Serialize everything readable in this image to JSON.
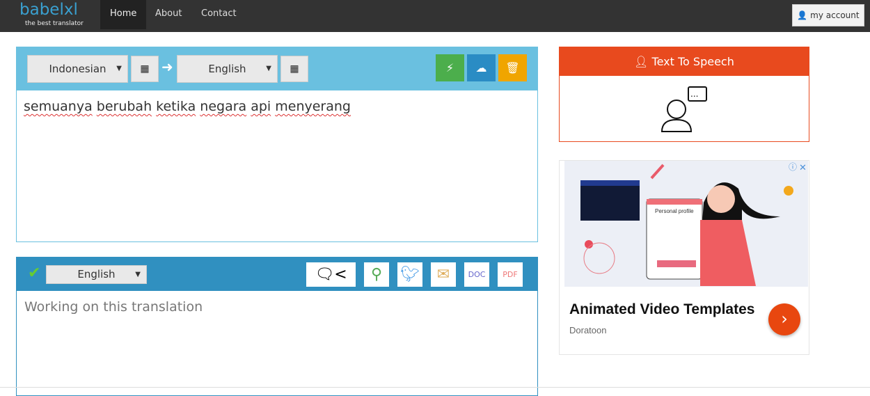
{
  "nav": {
    "logo": "babelxl",
    "tagline": "the best translator",
    "links": [
      "Home",
      "About",
      "Contact"
    ],
    "active": "Home",
    "account": "my account"
  },
  "source": {
    "language": "Indonesian",
    "target_language": "English",
    "text_words": [
      "semuanya",
      "berubah",
      "ketika",
      "negara",
      "api",
      "menyerang"
    ]
  },
  "output": {
    "language": "English",
    "placeholder": "Working on this translation",
    "share_icons": [
      "share-icon",
      "search-icon",
      "twitter-icon",
      "email-icon",
      "doc-icon",
      "pdf-icon"
    ],
    "doc_label": "DOC",
    "pdf_label": "PDF"
  },
  "tts": {
    "title": "Text To Speech"
  },
  "ad": {
    "title": "Animated Video Templates",
    "sponsor": "Doratoon",
    "image_text": "Personal profile"
  },
  "colors": {
    "nav": "#333333",
    "source_bar": "#6ac0e0",
    "output_bar": "#3090c0",
    "tts": "#e84a1e",
    "translate": "#4cae4c",
    "upload": "#2a8cc4",
    "delete": "#f0a500"
  }
}
